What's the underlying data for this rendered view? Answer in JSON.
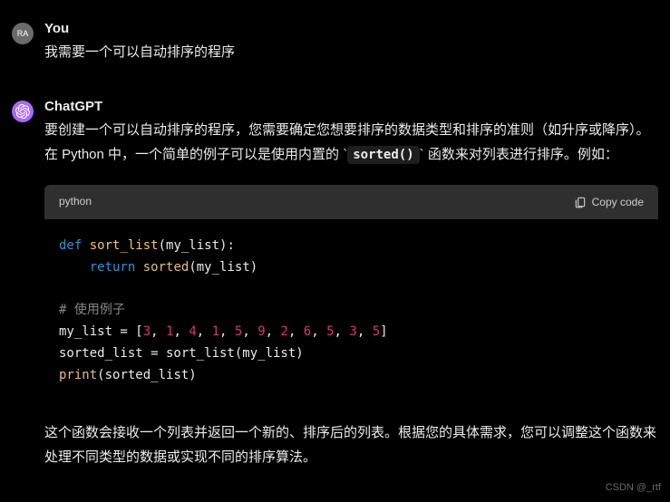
{
  "user": {
    "avatar_text": "RA",
    "name": "You",
    "message": "我需要一个可以自动排序的程序"
  },
  "assistant": {
    "name": "ChatGPT",
    "para1_a": "要创建一个可以自动排序的程序，您需要确定您想要排序的数据类型和排序的准则（如升序或降序）。在 Python 中，一个简单的例子可以是使用内置的 ",
    "inline_code": "sorted()",
    "para1_b": " 函数来对列表进行排序。例如：",
    "para2": "这个函数会接收一个列表并返回一个新的、排序后的列表。根据您的具体需求，您可以调整这个函数来处理不同类型的数据或实现不同的排序算法。"
  },
  "code": {
    "lang": "python",
    "copy_label": "Copy code",
    "tokens": {
      "def": "def",
      "fn_name": "sort_list",
      "sig": "(my_list):",
      "ret": "return",
      "sorted": "sorted",
      "args": "(my_list)",
      "comment": "# 使用例子",
      "line4a": "my_list = [",
      "nums": [
        "3",
        "1",
        "4",
        "1",
        "5",
        "9",
        "2",
        "6",
        "5",
        "3",
        "5"
      ],
      "line4b": "]",
      "line5": "sorted_list = sort_list(my_list)",
      "print": "print",
      "print_args": "(sorted_list)"
    }
  },
  "watermark": "CSDN @_rtf"
}
